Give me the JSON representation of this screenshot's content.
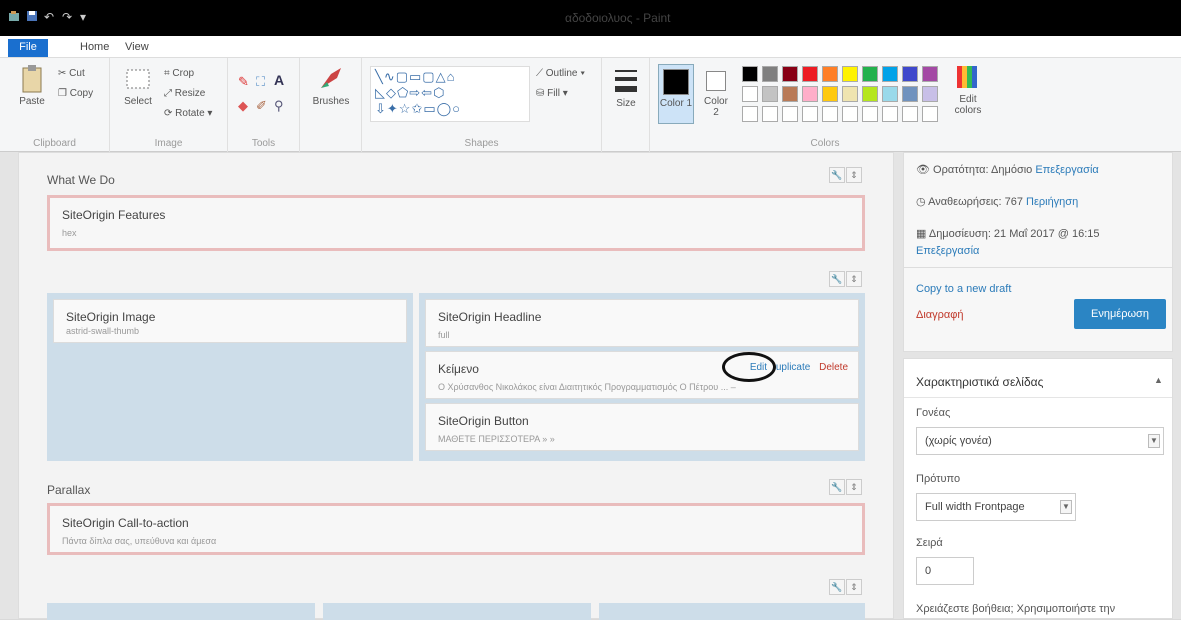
{
  "window": {
    "title": "αδοδοιολυος - Paint"
  },
  "ribbon": {
    "tabs": [
      "File",
      "Home",
      "View"
    ],
    "clipboard": {
      "paste": "Paste",
      "cut": "Cut",
      "copy": "Copy",
      "label": "Clipboard"
    },
    "image": {
      "select": "Select",
      "crop": "Crop",
      "resize": "Resize",
      "rotate": "Rotate ▾",
      "label": "Image"
    },
    "tools": {
      "label": "Tools"
    },
    "brushes": {
      "label": "Brushes"
    },
    "shapes": {
      "outline": "Outline ▾",
      "fill": "Fill ▾",
      "label": "Shapes"
    },
    "size": {
      "label": "Size"
    },
    "color1": "Color 1",
    "color2": "Color 2",
    "edit_colors": "Edit colors",
    "colors_label": "Colors",
    "palette": [
      "#000000",
      "#7f7f7f",
      "#880015",
      "#ed1c24",
      "#ff7f27",
      "#fff200",
      "#22b14c",
      "#00a2e8",
      "#3f48cc",
      "#a349a4",
      "#ffffff",
      "#c3c3c3",
      "#b97a57",
      "#ffaec9",
      "#ffc90e",
      "#efe4b0",
      "#b5e61d",
      "#99d9ea",
      "#7092be",
      "#c8bfe7"
    ]
  },
  "builder": {
    "row1": {
      "label": "What We Do",
      "widget": {
        "title": "SiteOrigin Features",
        "sub": "hex"
      }
    },
    "row2": {
      "left": {
        "title": "SiteOrigin Image",
        "sub": "astrid-swall-thumb"
      },
      "right": [
        {
          "title": "SiteOrigin Headline",
          "sub": "full"
        },
        {
          "title": "Κείμενο",
          "sub": "Ο Χρύσανθος Νικολάκος είναι Διαιτητικός Προγραμματισμός Ο Πέτρου ... – "
        },
        {
          "title": "SiteOrigin Button",
          "sub": "ΜΑΘΕΤΕ ΠΕΡΙΣΣΟΤΕΡΑ » »"
        }
      ],
      "actions": {
        "edit": "Edit",
        "duplicate": "uplicate",
        "delete": "Delete"
      }
    },
    "row3": {
      "label": "Parallax",
      "widget": {
        "title": "SiteOrigin Call-to-action",
        "sub": "Πάντα δίπλα σας, υπεύθυνα και άμεσα"
      }
    }
  },
  "sidebar": {
    "visibility": {
      "text": "Ορατότητα: Δημόσιο",
      "link": "Επεξεργασία"
    },
    "revisions": {
      "text": "Αναθεωρήσεις: 767",
      "link": "Περιήγηση"
    },
    "published": {
      "text": "Δημοσίευση: 21 Μαΐ 2017 @ 16:15",
      "link": "Επεξεργασία"
    },
    "copy_draft": "Copy to a new draft",
    "trash": "Διαγραφή",
    "update": "Ενημέρωση",
    "attributes": {
      "title": "Χαρακτηριστικά σελίδας",
      "parent_label": "Γονέας",
      "parent_value": "(χωρίς γονέα)",
      "template_label": "Πρότυπο",
      "template_value": "Full width Frontpage",
      "order_label": "Σειρά",
      "order_value": "0",
      "help": "Χρειάζεστε βοήθεια; Χρησιμοποιήστε την"
    }
  }
}
